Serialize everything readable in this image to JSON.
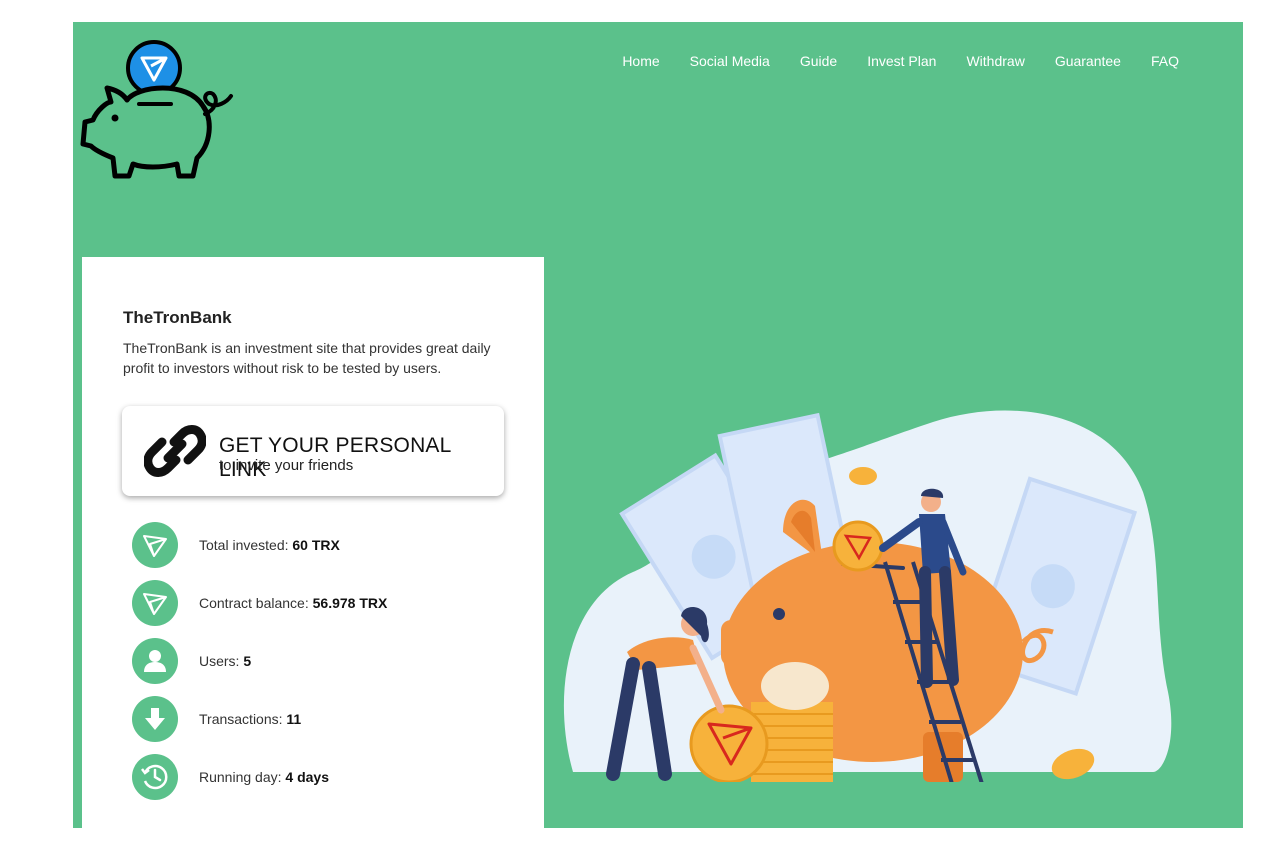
{
  "nav": {
    "items": [
      "Home",
      "Social Media",
      "Guide",
      "Invest Plan",
      "Withdraw",
      "Guarantee",
      "FAQ"
    ]
  },
  "card": {
    "title": "TheTronBank",
    "description": "TheTronBank is an investment site that provides great daily profit to investors without risk to be tested by users.",
    "link_button": {
      "title": "GET YOUR PERSONAL LINK",
      "subtitle": "to invite your friends"
    }
  },
  "stats": [
    {
      "label": "Total invested:",
      "value": "60 TRX",
      "icon": "tron-icon"
    },
    {
      "label": "Contract balance:",
      "value": "56.978 TRX",
      "icon": "tron-icon"
    },
    {
      "label": "Users:",
      "value": "5",
      "icon": "user-icon"
    },
    {
      "label": "Transactions:",
      "value": "11",
      "icon": "arrow-down-icon"
    },
    {
      "label": "Running day:",
      "value": "4 days",
      "icon": "clock-icon"
    }
  ],
  "colors": {
    "brand_green": "#5bc18b",
    "pig_orange": "#f39644",
    "tron_blue": "#1e90e6",
    "coin_gold": "#f7b23b"
  }
}
